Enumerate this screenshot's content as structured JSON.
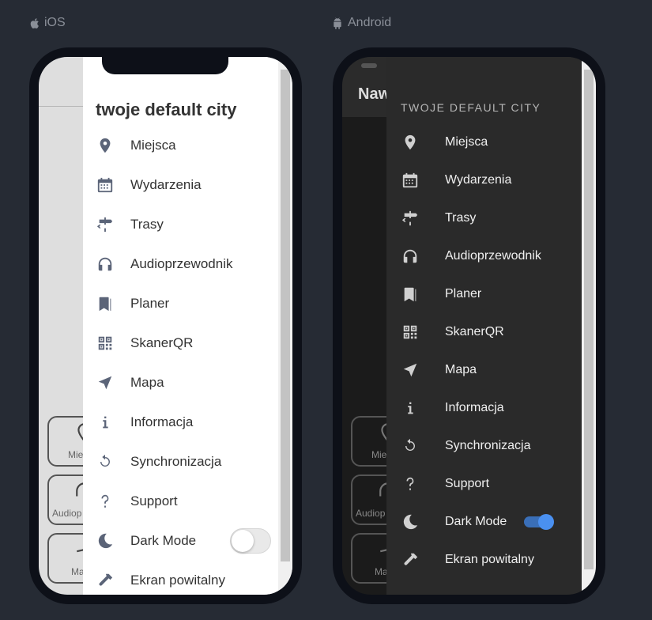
{
  "ios": {
    "platform_label": "iOS",
    "drawer_title": "twoje default city",
    "background_tiles": [
      "Mie",
      "Audiop",
      "Ma"
    ],
    "menu": [
      {
        "label": "Miejsca",
        "icon": "map-pin-icon"
      },
      {
        "label": "Wydarzenia",
        "icon": "calendar-icon"
      },
      {
        "label": "Trasy",
        "icon": "signpost-icon"
      },
      {
        "label": "Audioprzewodnik",
        "icon": "headphones-icon"
      },
      {
        "label": "Planer",
        "icon": "bookmark-icon"
      },
      {
        "label": "SkanerQR",
        "icon": "qr-code-icon"
      },
      {
        "label": "Mapa",
        "icon": "navigation-arrow-icon"
      },
      {
        "label": "Informacja",
        "icon": "info-icon"
      },
      {
        "label": "Synchronizacja",
        "icon": "sync-icon"
      },
      {
        "label": "Support",
        "icon": "question-icon"
      },
      {
        "label": "Dark Mode",
        "icon": "moon-icon",
        "toggle": false
      },
      {
        "label": "Ekran powitalny",
        "icon": "hammer-icon"
      }
    ]
  },
  "android": {
    "platform_label": "Android",
    "app_bar_title": "Naw",
    "drawer_title": "TWOJE DEFAULT CITY",
    "background_tiles": [
      "Mie",
      "Audiop",
      "Ma"
    ],
    "menu": [
      {
        "label": "Miejsca",
        "icon": "map-pin-icon"
      },
      {
        "label": "Wydarzenia",
        "icon": "calendar-icon"
      },
      {
        "label": "Trasy",
        "icon": "signpost-icon"
      },
      {
        "label": "Audioprzewodnik",
        "icon": "headphones-icon"
      },
      {
        "label": "Planer",
        "icon": "bookmark-icon"
      },
      {
        "label": "SkanerQR",
        "icon": "qr-code-icon"
      },
      {
        "label": "Mapa",
        "icon": "navigation-arrow-icon"
      },
      {
        "label": "Informacja",
        "icon": "info-icon"
      },
      {
        "label": "Synchronizacja",
        "icon": "sync-icon"
      },
      {
        "label": "Support",
        "icon": "question-icon"
      },
      {
        "label": "Dark Mode",
        "icon": "moon-icon",
        "toggle": true
      },
      {
        "label": "Ekran powitalny",
        "icon": "hammer-icon"
      }
    ]
  },
  "colors": {
    "page_background": "#262b34",
    "ios_icon": "#5b6478",
    "android_accent": "#4a90f0"
  }
}
